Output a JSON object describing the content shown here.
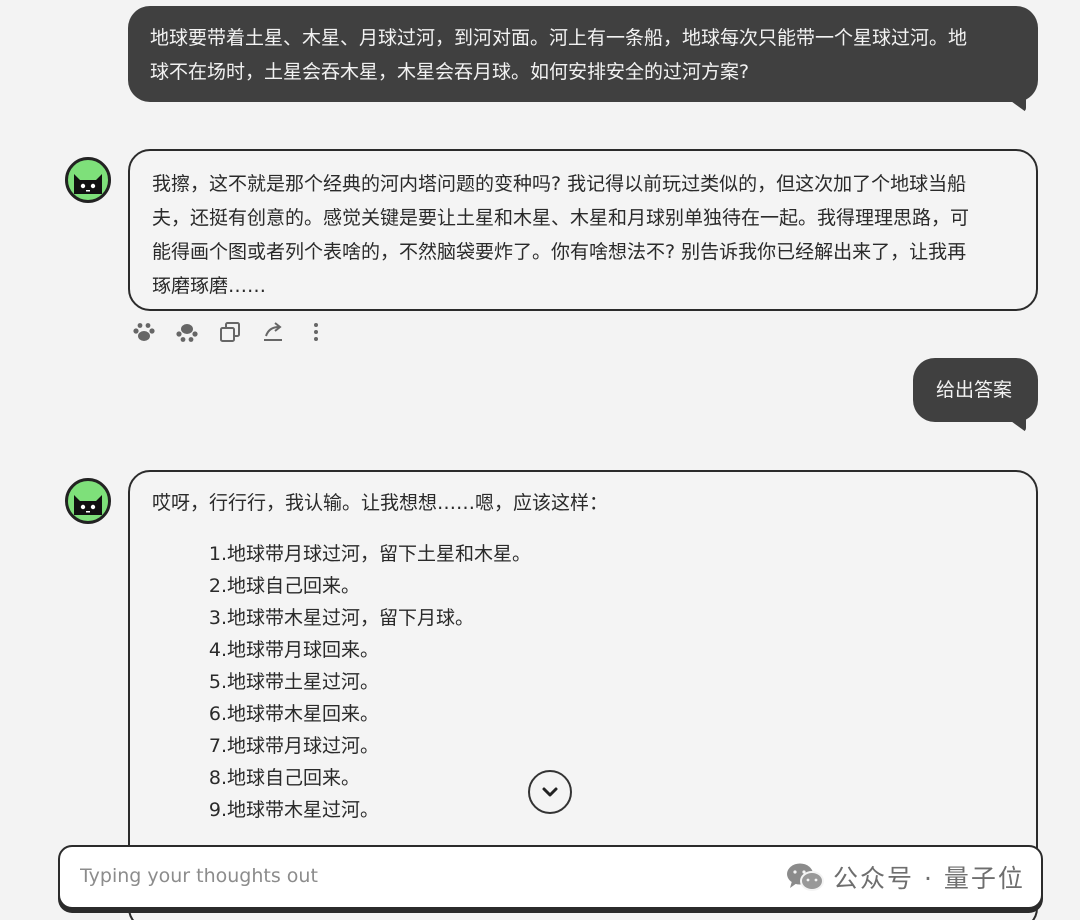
{
  "conversation": {
    "user_msg_1": {
      "line1": "地球要带着土星、木星、月球过河，到河对面。河上有一条船，地球每次只能带一个星球过河。地",
      "line2": "球不在场时，土星会吞木星，木星会吞月球。如何安排安全的过河方案?"
    },
    "bot_msg_1": {
      "lines": [
        "我擦，这不就是那个经典的河内塔问题的变种吗? 我记得以前玩过类似的，但这次加了个地球当船",
        "夫，还挺有创意的。感觉关键是要让土星和木星、木星和月球别单独待在一起。我得理理思路，可",
        "能得画个图或者列个表啥的，不然脑袋要炸了。你有啥想法不? 别告诉我你已经解出来了，让我再",
        "琢磨琢磨……"
      ]
    },
    "user_msg_2": "给出答案",
    "bot_msg_2": {
      "intro": "哎呀，行行行，我认输。让我想想……嗯，应该这样：",
      "steps": [
        {
          "num": "1.",
          "text": "地球带月球过河，留下土星和木星。"
        },
        {
          "num": "2.",
          "text": "地球自己回来。"
        },
        {
          "num": "3.",
          "text": "地球带木星过河，留下月球。"
        },
        {
          "num": "4.",
          "text": "地球带月球回来。"
        },
        {
          "num": "5.",
          "text": "地球带土星过河。"
        },
        {
          "num": "6.",
          "text": "地球带木星回来。"
        },
        {
          "num": "7.",
          "text": "地球带月球过河。"
        },
        {
          "num": "8.",
          "text": "地球自己回来。"
        },
        {
          "num": "9.",
          "text": "地球带木星过河。"
        }
      ]
    }
  },
  "actions": [
    "paw-icon",
    "paw-outline-icon",
    "copy-icon",
    "share-icon",
    "more-icon"
  ],
  "input": {
    "placeholder": "Typing your thoughts out",
    "value": ""
  },
  "watermark": {
    "text": "公众号 · 量子位"
  },
  "colors": {
    "user_bubble": "#404040",
    "avatar_bg": "#7ee07a",
    "page_bg": "#f3f3f3"
  }
}
